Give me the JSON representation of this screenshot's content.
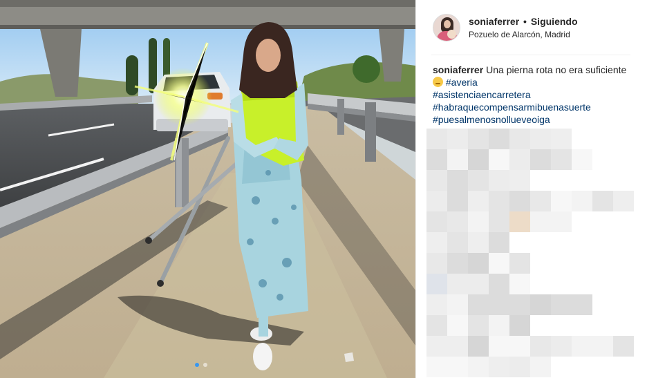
{
  "post": {
    "username": "soniaferrer",
    "separator": "•",
    "follow_status": "Siguiendo",
    "location": "Pozuelo de Alarcón, Madrid",
    "caption_user": "soniaferrer",
    "caption_text": "Una pierna rota no era suficiente",
    "hashtags": [
      "#averia",
      "#asistenciaencarretera",
      "#habraquecompensarmibuenasuerte",
      "#puesalmenosnollueveoiga"
    ],
    "carousel": {
      "count": 2,
      "active": 0
    }
  },
  "colors": {
    "hashtag": "#003569",
    "carousel_active": "#3897f0",
    "safety_vest": "#c8f02a"
  },
  "icons": {
    "emoji": "pouting-face-emoji"
  }
}
